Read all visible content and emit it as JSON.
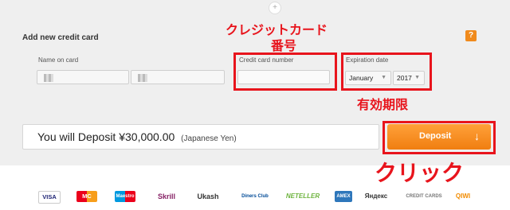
{
  "form": {
    "title": "Add new credit card",
    "name_label": "Name on card",
    "card_number_label": "Credit card number",
    "expiry_label": "Expiration date",
    "month_value": "January",
    "year_value": "2017",
    "help_symbol": "?"
  },
  "annotations": {
    "card_number_line1": "クレジットカード",
    "card_number_line2": "番号",
    "expiry": "有効期限",
    "click": "クリック"
  },
  "deposit": {
    "text": "You will Deposit ¥30,000.00",
    "currency": "(Japanese Yen)",
    "button_label": "Deposit",
    "button_arrow": "↓"
  },
  "payment_logos": [
    "VISA",
    "MC",
    "Maestro",
    "Skrill",
    "Ukash",
    "Diners Club",
    "NETELLER",
    "AMEX",
    "Яндекс",
    "CREDIT CARDS",
    "QIWI"
  ],
  "colors": {
    "annotation_red": "#e8141c",
    "button_orange": "#f59020",
    "panel_bg": "#efefef"
  }
}
